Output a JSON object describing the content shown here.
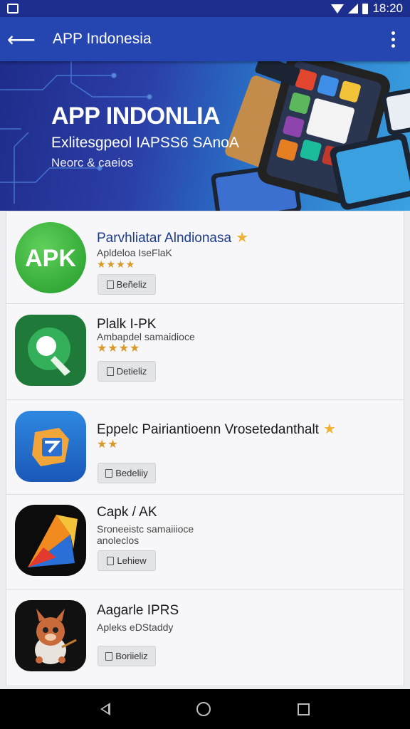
{
  "status_bar": {
    "time": "18:20"
  },
  "app_bar": {
    "title": "APP Indonesia"
  },
  "banner": {
    "title": "APP INDONLIA",
    "subtitle": "Exlitesgpeol IAPSS6 SAnoA",
    "caption": "Neorc & caeios"
  },
  "apps": [
    {
      "name": "Parvhliatar Alndionasa",
      "desc": "Apldeloa IseFlaK",
      "stars": "★★★★",
      "badge": "★",
      "button": "Beñeliz",
      "icon": "apk-green-icon"
    },
    {
      "name": "Plalk I-PK",
      "desc": "Ambapdel samaidioce",
      "stars": "★★★★",
      "badge": "",
      "button": "Detieliz",
      "icon": "magnifier-green-icon"
    },
    {
      "name": "Eppelc Pairiantioenn Vrosetedanthalt",
      "desc": "",
      "stars": "★★",
      "badge": "★",
      "button": "Bedeliiy",
      "icon": "blue-box-icon"
    },
    {
      "name": "Capk / AK",
      "desc": "Sroneeistc samaiiioce",
      "desc2": "anoleclos",
      "stars": "",
      "badge": "",
      "button": "Lehiew",
      "icon": "paper-plane-icon"
    },
    {
      "name": "Aagarle IPRS",
      "desc": "Apleks eDStaddy",
      "stars": "",
      "badge": "",
      "button": "Boriieliz",
      "icon": "llama-mascot-icon"
    }
  ]
}
